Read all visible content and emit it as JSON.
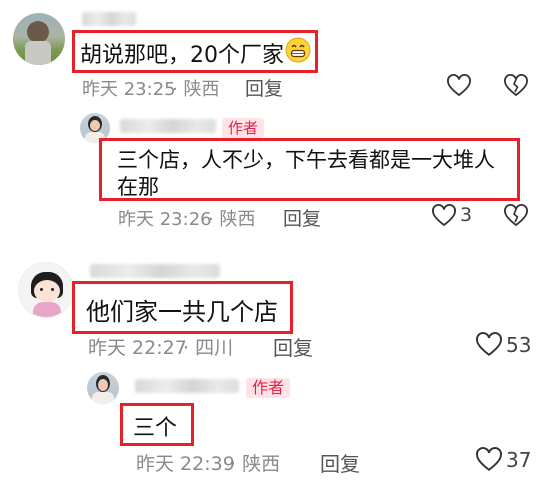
{
  "comments": [
    {
      "text": "胡说那吧，20个厂家",
      "emoji": "grinning-emoji",
      "time": "昨天 23:25",
      "location": "· 陕西",
      "reply_label": "回复",
      "like_count": ""
    },
    {
      "badge": "作者",
      "text_line1": "三个店，人不少，下午去看都是一大堆人",
      "text_line2": "在那",
      "time": "昨天 23:26",
      "location": "· 陕西",
      "reply_label": "回复",
      "like_count": "3"
    },
    {
      "text": "他们家一共几个店",
      "time": "昨天 22:27",
      "location": "· 四川",
      "reply_label": "回复",
      "like_count": "53"
    },
    {
      "badge": "作者",
      "text": "三个",
      "time": "昨天 22:39",
      "location": "· 陕西",
      "reply_label": "回复",
      "like_count": "37"
    }
  ],
  "colors": {
    "highlight_border": "#e8202a",
    "author_badge_bg": "#ffe3e6",
    "author_badge_text": "#e4234a",
    "meta_text": "#8a8a8a"
  }
}
